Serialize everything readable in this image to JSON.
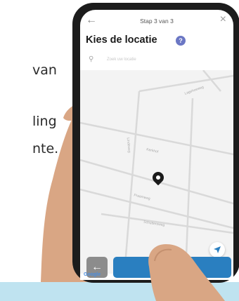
{
  "background_text": {
    "line1": "van",
    "line2": "ling",
    "line3": "nte."
  },
  "header": {
    "back_icon": "arrow-left-icon",
    "step_label": "Stap 3 van 3",
    "close_icon": "close-icon"
  },
  "title": "Kies de locatie",
  "help_label": "?",
  "search": {
    "placeholder": "Zoek uw locatie",
    "icon": "search-icon"
  },
  "map": {
    "streets": [
      "Lagehoeweg",
      "Kerkhof",
      "Lindeweg",
      "Praamweg",
      "Schuttersweg"
    ],
    "pin_icon": "map-pin-icon",
    "locate_icon": "navigation-arrow-icon"
  },
  "footer": {
    "prev_label": "←",
    "attribution": "Google"
  },
  "colors": {
    "primary_button": "#2a7fc0",
    "secondary_button": "#8c8c8c",
    "help_badge": "#6b77c4",
    "info_strip": "#bfe3f0"
  }
}
